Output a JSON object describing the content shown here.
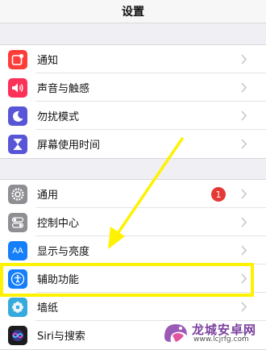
{
  "header": {
    "title": "设置"
  },
  "group1": [
    {
      "label": "通知",
      "icon": "notifications-icon",
      "color": "#fc3d39"
    },
    {
      "label": "声音与触感",
      "icon": "sound-icon",
      "color": "#fc3158"
    },
    {
      "label": "勿扰模式",
      "icon": "moon-icon",
      "color": "#5856d6"
    },
    {
      "label": "屏幕使用时间",
      "icon": "hourglass-icon",
      "color": "#5856d6"
    }
  ],
  "group2": [
    {
      "label": "通用",
      "icon": "gear-icon",
      "color": "#8e8e93",
      "badge": "1"
    },
    {
      "label": "控制中心",
      "icon": "toggles-icon",
      "color": "#8e8e93"
    },
    {
      "label": "显示与亮度",
      "icon": "text-size-icon",
      "color": "#147efb",
      "icon_text": "AA"
    },
    {
      "label": "辅助功能",
      "icon": "accessibility-icon",
      "color": "#147efb"
    },
    {
      "label": "墙纸",
      "icon": "wallpaper-icon",
      "color": "#35aadc"
    },
    {
      "label": "Siri与搜索",
      "icon": "siri-icon",
      "color": "#1c1c1e"
    }
  ],
  "annotation": {
    "highlight_color": "#fff200",
    "highlighted_item": "辅助功能"
  },
  "watermark": {
    "title": "龙城安卓网",
    "url": "www.lcjrfg.com",
    "color": "#7b3f9e"
  }
}
